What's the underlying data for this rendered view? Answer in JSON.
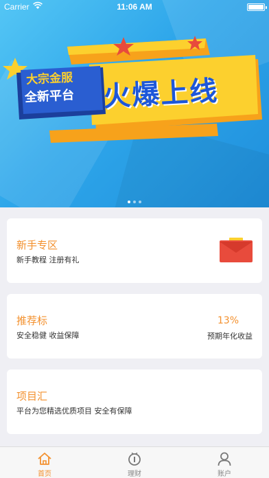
{
  "status_bar": {
    "carrier": "Carrier",
    "time": "11:06 AM"
  },
  "banner": {
    "tag_line1": "大宗金服",
    "tag_line2": "全新平台",
    "headline": "火爆上线",
    "page_count": 3,
    "current_page": 1
  },
  "cards": [
    {
      "title": "新手专区",
      "subtitle": "新手教程 注册有礼",
      "icon": "red-envelope-icon",
      "icon_glyph": "¥"
    },
    {
      "title": "推荐标",
      "subtitle": "安全稳健 收益保障",
      "rate": "13%",
      "rate_label": "预期年化收益"
    },
    {
      "title": "项目汇",
      "subtitle": "平台为您精选优质项目 安全有保障"
    }
  ],
  "tab_bar": {
    "items": [
      {
        "label": "首页",
        "icon": "home-icon",
        "active": true
      },
      {
        "label": "理财",
        "icon": "finance-icon",
        "active": false
      },
      {
        "label": "账户",
        "icon": "account-icon",
        "active": false
      }
    ]
  },
  "colors": {
    "accent": "#f3902d",
    "banner_blue": "#2ea6ea",
    "ribbon_yellow": "#fcd02e",
    "ribbon_red": "#e84b3c"
  }
}
